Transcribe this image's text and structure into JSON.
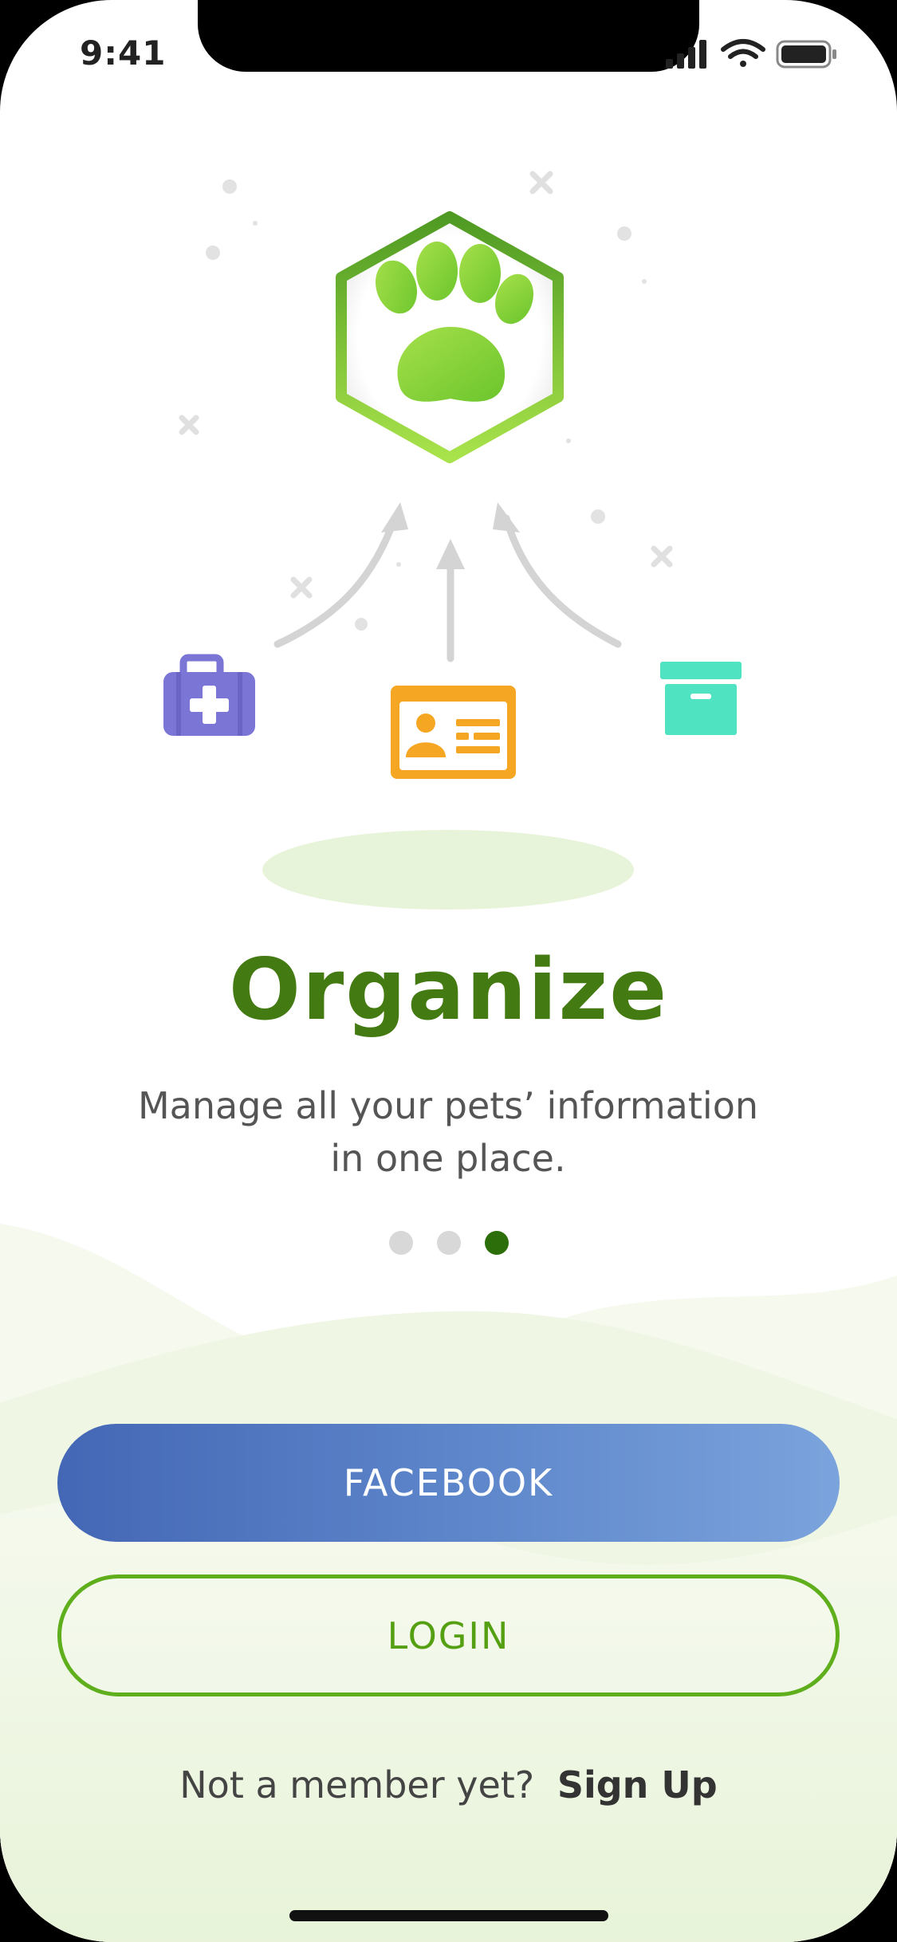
{
  "status_bar": {
    "time": "9:41",
    "signal_icon": "cellular-signal-icon",
    "wifi_icon": "wifi-icon",
    "battery_icon": "battery-icon"
  },
  "illustration": {
    "center_icon": "paw-badge-icon",
    "left_icon": "medical-kit-icon",
    "middle_icon": "id-card-icon",
    "right_icon": "storage-box-icon",
    "colors": {
      "paw_green": "#7ed321",
      "medical_purple": "#7b75d6",
      "id_orange": "#f5a623",
      "box_teal": "#50e3c2",
      "arrow_gray": "#d0d0d0"
    }
  },
  "onboarding": {
    "title": "Organize",
    "subtitle": "Manage all your pets’ information in one place.",
    "page_count": 3,
    "active_page": 3
  },
  "actions": {
    "facebook_label": "FACEBOOK",
    "login_label": "LOGIN",
    "signup_prompt": "Not a member yet?",
    "signup_link": "Sign Up"
  },
  "theme": {
    "title_color": "#447a12",
    "facebook_gradient_start": "#4467b5",
    "facebook_gradient_end": "#7ba3dc",
    "login_border": "#5fae1c"
  }
}
